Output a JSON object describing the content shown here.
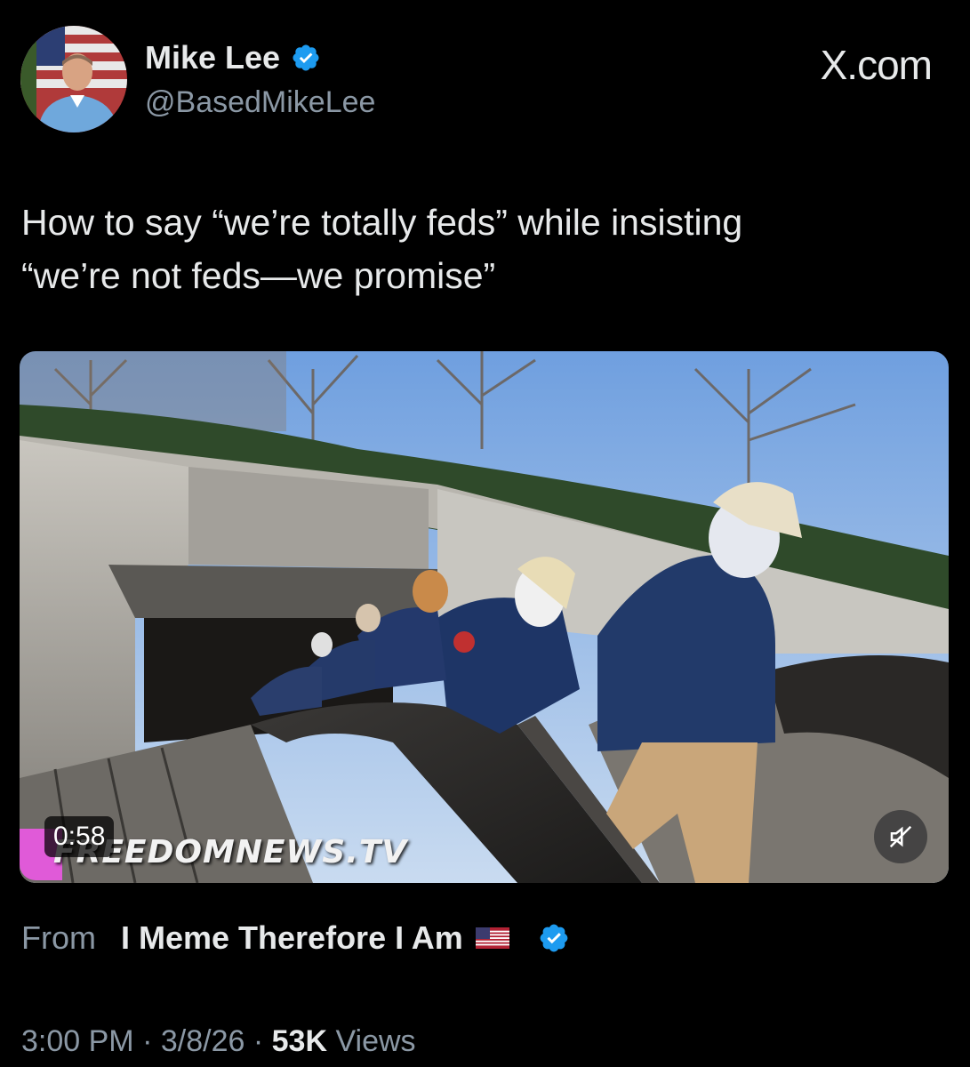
{
  "author": {
    "name": "Mike Lee",
    "handle": "@BasedMikeLee",
    "verified": true,
    "verified_color": "#1d9bf0"
  },
  "brand": "X.com",
  "tweet": {
    "line1": "How to say “we’re totally feds” while insisting",
    "line2": "“we’re not feds—we promise”"
  },
  "video": {
    "duration": "0:58",
    "watermark": "FREEDOMNEWS.TV",
    "muted": true
  },
  "source": {
    "from_label": "From",
    "name": "I Meme Therefore I Am",
    "flag_icon": "us-flag-icon",
    "verified": true
  },
  "meta": {
    "time": "3:00 PM",
    "date": "3/8/26",
    "separator": "·",
    "views_count": "53K",
    "views_label": "Views"
  },
  "colors": {
    "background": "#000000",
    "text": "#e7e9ea",
    "muted_text": "#8b98a5",
    "accent": "#1d9bf0"
  }
}
